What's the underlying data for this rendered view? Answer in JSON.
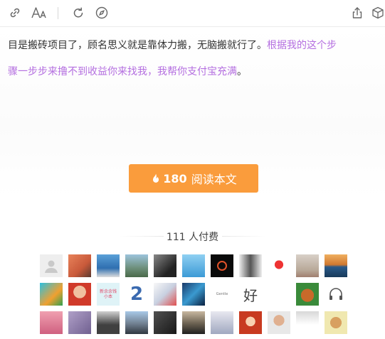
{
  "toolbar": {
    "left_icons": [
      "link-icon",
      "font-size-icon",
      "refresh-icon",
      "compass-icon"
    ],
    "right_icons": [
      "share-icon",
      "cube-icon"
    ]
  },
  "article": {
    "line1_plain": "目是搬砖项目了，顾名思义就是靠体力搬，无脑搬就行了。",
    "line1_purple": "根据我的这个步",
    "line2_purple": "骤一步步来撸不到收益你来找我，我帮你支付宝充满",
    "line2_plain": "。"
  },
  "read_button": {
    "count": "180",
    "label": "阅读本文",
    "color": "#fa9c3c"
  },
  "payers": {
    "label": "111 人付费"
  },
  "avatars": [
    {
      "name": "avatar-default",
      "icon": "person-icon"
    },
    {
      "name": "avatar-orange-portrait"
    },
    {
      "name": "avatar-blue-sky"
    },
    {
      "name": "avatar-landscape"
    },
    {
      "name": "avatar-bw-man"
    },
    {
      "name": "avatar-blue-figure"
    },
    {
      "name": "avatar-black-ring"
    },
    {
      "name": "avatar-suit"
    },
    {
      "name": "avatar-cartoon-girl"
    },
    {
      "name": "avatar-dog-walk"
    },
    {
      "name": "avatar-sunset-sea"
    },
    {
      "name": "avatar-bird"
    },
    {
      "name": "avatar-boy-red"
    },
    {
      "name": "avatar-text-card",
      "text": "新余余钱\n小本"
    },
    {
      "name": "avatar-number-2",
      "text": "2"
    },
    {
      "name": "avatar-anime-girl"
    },
    {
      "name": "avatar-blue-swirl"
    },
    {
      "name": "avatar-small-text",
      "text": "Gentle"
    },
    {
      "name": "avatar-hao",
      "text": "好"
    },
    {
      "name": "avatar-blank"
    },
    {
      "name": "avatar-cartoon-bear"
    },
    {
      "name": "avatar-headphones"
    },
    {
      "name": "avatar-pink-girl"
    },
    {
      "name": "avatar-purple-photo"
    },
    {
      "name": "avatar-dark-figure"
    },
    {
      "name": "avatar-mountain"
    },
    {
      "name": "avatar-dark-photo"
    },
    {
      "name": "avatar-dusk-sky"
    },
    {
      "name": "avatar-anime-white"
    },
    {
      "name": "avatar-red-hair"
    },
    {
      "name": "avatar-man-glasses"
    },
    {
      "name": "avatar-white-shirt"
    },
    {
      "name": "avatar-cartoon-monkey"
    }
  ]
}
